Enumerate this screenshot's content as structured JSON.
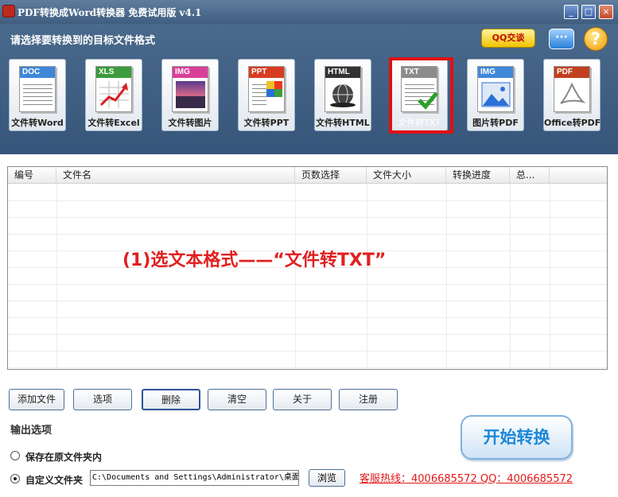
{
  "window": {
    "title": "PDF转换成Word转换器 免费试用版 v4.1",
    "min_icon": "minimize-icon",
    "max_icon": "maximize-icon",
    "close_icon": "close-icon"
  },
  "toolbar": {
    "prompt": "请选择要转换到的目标文件格式",
    "qq_label": "QQ交谈",
    "chat_icon": "chat-bubble-icon",
    "help_icon": "question-mark-icon",
    "formats": [
      {
        "tag": "DOC",
        "label": "文件转Word",
        "color": "#3f88d8"
      },
      {
        "tag": "XLS",
        "label": "文件转Excel",
        "color": "#3c9b3c"
      },
      {
        "tag": "IMG",
        "label": "文件转图片",
        "color": "#d84098"
      },
      {
        "tag": "PPT",
        "label": "文件转PPT",
        "color": "#d83c20"
      },
      {
        "tag": "HTML",
        "label": "文件转HTML",
        "color": "#333333"
      },
      {
        "tag": "TXT",
        "label": "文件转TXT",
        "color": "#8c8c8c",
        "selected": true
      },
      {
        "tag": "IMG",
        "label": "图片转PDF",
        "color": "#3f88d8"
      },
      {
        "tag": "PDF",
        "label": "Office转PDF",
        "color": "#c04020"
      }
    ]
  },
  "table": {
    "columns": [
      "编号",
      "文件名",
      "页数选择",
      "文件大小",
      "转换进度",
      "总..."
    ]
  },
  "annotation": "(1)选文本格式——“文件转TXT”",
  "buttons": {
    "add": "添加文件",
    "options": "选项",
    "delete": "删除",
    "clear": "清空",
    "about": "关于",
    "register": "注册"
  },
  "output": {
    "title": "输出选项",
    "save_original": "保存在原文件夹内",
    "custom_folder": "自定义文件夹",
    "path": "C:\\Documents and Settings\\Administrator\\桌面",
    "browse": "浏览"
  },
  "hotline": "客服热线：4006685572 QQ：4006685572",
  "start": "开始转换"
}
